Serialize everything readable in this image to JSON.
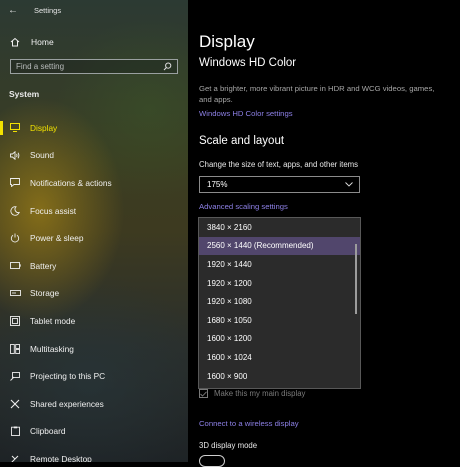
{
  "window": {
    "title": "Settings"
  },
  "sidebar": {
    "home_label": "Home",
    "search_placeholder": "Find a setting",
    "section": "System",
    "items": [
      {
        "label": "Display",
        "icon": "monitor-icon",
        "active": true
      },
      {
        "label": "Sound",
        "icon": "speaker-icon"
      },
      {
        "label": "Notifications & actions",
        "icon": "notification-icon"
      },
      {
        "label": "Focus assist",
        "icon": "moon-icon"
      },
      {
        "label": "Power & sleep",
        "icon": "power-icon"
      },
      {
        "label": "Battery",
        "icon": "battery-icon"
      },
      {
        "label": "Storage",
        "icon": "storage-icon"
      },
      {
        "label": "Tablet mode",
        "icon": "tablet-icon"
      },
      {
        "label": "Multitasking",
        "icon": "multitasking-icon"
      },
      {
        "label": "Projecting to this PC",
        "icon": "projector-icon"
      },
      {
        "label": "Shared experiences",
        "icon": "shared-icon"
      },
      {
        "label": "Clipboard",
        "icon": "clipboard-icon"
      },
      {
        "label": "Remote Desktop",
        "icon": "remote-icon"
      }
    ]
  },
  "main": {
    "title": "Display",
    "hdr": {
      "heading": "Windows HD Color",
      "description": "Get a brighter, more vibrant picture in HDR and WCG videos, games, and apps.",
      "link": "Windows HD Color settings"
    },
    "scale": {
      "heading": "Scale and layout",
      "label": "Change the size of text, apps, and other items",
      "value": "175%",
      "advanced_link": "Advanced scaling settings"
    },
    "resolution_options": [
      "3840 × 2160",
      "2560 × 1440 (Recommended)",
      "1920 × 1440",
      "1920 × 1200",
      "1920 × 1080",
      "1680 × 1050",
      "1600 × 1200",
      "1600 × 1024",
      "1600 × 900"
    ],
    "selected_resolution_index": 1,
    "main_display_label": "Make this my main display",
    "wireless_link": "Connect to a wireless display",
    "threed_heading": "3D display mode"
  },
  "colors": {
    "accent": "#f2e200",
    "link": "#8d80e6",
    "selection": "#51466c"
  }
}
